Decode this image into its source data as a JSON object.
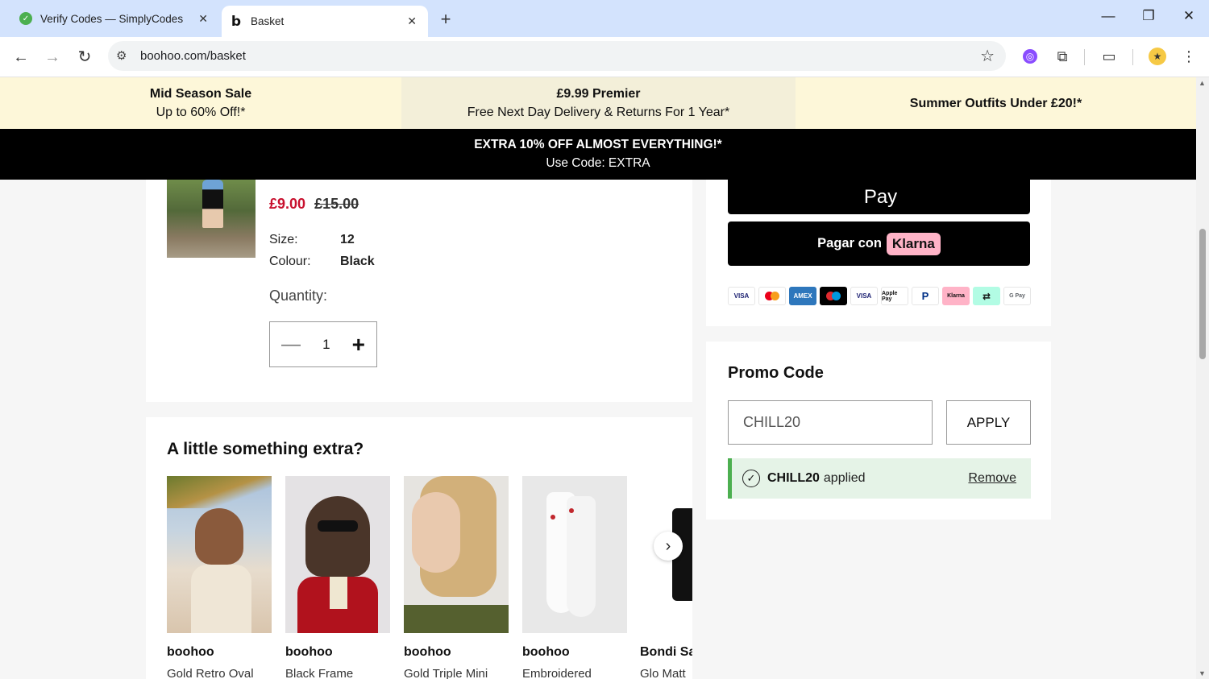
{
  "browser": {
    "tabs": [
      {
        "title": "Verify Codes — SimplyCodes",
        "active": false
      },
      {
        "title": "Basket",
        "active": true
      }
    ],
    "url": "boohoo.com/basket"
  },
  "promo_bar": {
    "cell1": {
      "title": "Mid Season Sale",
      "subtitle": "Up to 60% Off!*"
    },
    "cell2": {
      "title": "£9.99 Premier",
      "subtitle": "Free Next Day Delivery & Returns For 1 Year*"
    },
    "cell3": {
      "title": "Summer Outfits Under £20!*"
    }
  },
  "extra_bar": {
    "title": "EXTRA 10% OFF ALMOST EVERYTHING!*",
    "subtitle": "Use Code: EXTRA"
  },
  "product": {
    "price_now": "£9.00",
    "price_was": "£15.00",
    "size_label": "Size:",
    "size_value": "12",
    "colour_label": "Colour:",
    "colour_value": "Black",
    "quantity_label": "Quantity:",
    "quantity_value": "1"
  },
  "extras": {
    "title": "A little something extra?",
    "items": [
      {
        "brand": "boohoo",
        "name": "Gold Retro Oval"
      },
      {
        "brand": "boohoo",
        "name": "Black Frame"
      },
      {
        "brand": "boohoo",
        "name": "Gold Triple Mini"
      },
      {
        "brand": "boohoo",
        "name": "Embroidered"
      },
      {
        "brand": "Bondi Sa",
        "name": "Glo Matt"
      }
    ]
  },
  "payment": {
    "apple_pay_label": "Pay",
    "klarna_prefix": "Pagar con",
    "klarna_brand": "Klarna",
    "logos": [
      "VISA",
      "MC",
      "AMEX",
      "Maestro",
      "VISA",
      "Apple Pay",
      "PayPal",
      "Klarna",
      "Clearpay",
      "G Pay"
    ]
  },
  "promo": {
    "title": "Promo Code",
    "input_value": "CHILL20",
    "apply_label": "APPLY",
    "applied_code": "CHILL20",
    "applied_text": "applied",
    "remove_label": "Remove"
  },
  "colors": {
    "sale_red": "#c8102e",
    "promo_yellow": "#fdf7d9",
    "klarna_pink": "#ffb3c7",
    "applied_green": "#4caf50"
  }
}
